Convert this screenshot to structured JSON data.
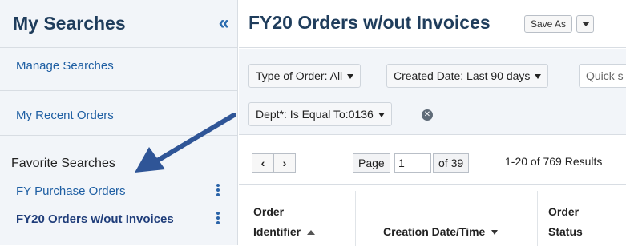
{
  "sidebar": {
    "title": "My Searches",
    "collapse_glyph": "«",
    "links": [
      {
        "label": "Manage Searches"
      },
      {
        "label": "My Recent Orders"
      }
    ],
    "favorites_heading": "Favorite Searches",
    "favorites": [
      {
        "label": "FY Purchase Orders"
      },
      {
        "label": "FY20 Orders w/out Invoices",
        "active": true
      }
    ]
  },
  "header": {
    "title": "FY20 Orders w/out Invoices",
    "save_as_label": "Save As"
  },
  "filters": {
    "chips": [
      {
        "label": "Type of Order: All"
      },
      {
        "label": "Created Date: Last 90 days"
      },
      {
        "label": "Dept*: Is Equal To:0136"
      }
    ],
    "quick_search_placeholder": "Quick s"
  },
  "pager": {
    "page_label": "Page",
    "page_value": "1",
    "of_label": "of 39",
    "results_label": "1-20 of 769 Results"
  },
  "table": {
    "columns": [
      {
        "line1": "Order",
        "line2": "Identifier"
      },
      {
        "line1": "",
        "line2": "Creation Date/Time"
      },
      {
        "line1": "Order",
        "line2": "Status"
      }
    ]
  },
  "colors": {
    "accent": "#1f5fa3",
    "title": "#1f3d5c",
    "arrow": "#2f5597"
  },
  "icons": [
    "collapse-sidebar-icon",
    "kebab-menu-icon",
    "dropdown-caret-icon",
    "clear-filter-icon",
    "prev-page-icon",
    "next-page-icon",
    "sort-ascending-icon"
  ]
}
